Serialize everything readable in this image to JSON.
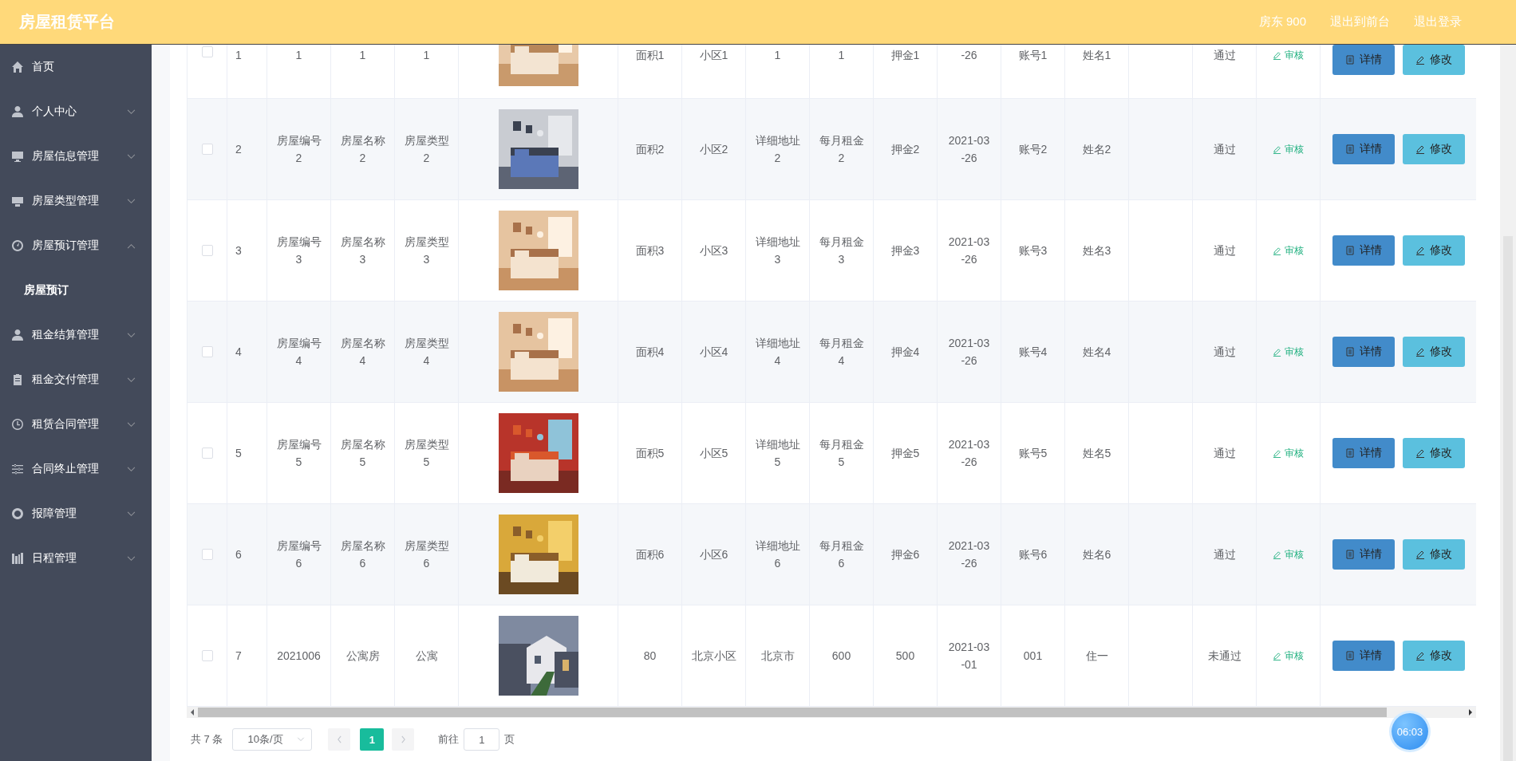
{
  "header": {
    "title": "房屋租赁平台",
    "links": [
      "房东 900",
      "退出到前台",
      "退出登录"
    ]
  },
  "sidebar": {
    "items": [
      {
        "label": "首页",
        "kind": "link"
      },
      {
        "label": "个人中心",
        "kind": "menu",
        "expanded": false
      },
      {
        "label": "房屋信息管理",
        "kind": "menu",
        "expanded": false
      },
      {
        "label": "房屋类型管理",
        "kind": "menu",
        "expanded": false
      },
      {
        "label": "房屋预订管理",
        "kind": "menu",
        "expanded": true,
        "children": [
          {
            "label": "房屋预订"
          }
        ]
      },
      {
        "label": "租金结算管理",
        "kind": "menu",
        "expanded": false
      },
      {
        "label": "租金交付管理",
        "kind": "menu",
        "expanded": false
      },
      {
        "label": "租赁合同管理",
        "kind": "menu",
        "expanded": false
      },
      {
        "label": "合同终止管理",
        "kind": "menu",
        "expanded": false
      },
      {
        "label": "报障管理",
        "kind": "menu",
        "expanded": false
      },
      {
        "label": "日程管理",
        "kind": "menu",
        "expanded": false
      }
    ]
  },
  "table": {
    "rows": [
      {
        "checked": false,
        "index": "1",
        "lead": [
          "1",
          "1",
          "1"
        ],
        "tail": [
          "面积1",
          "小区1",
          "1",
          "1",
          "押金1",
          "-26",
          "账号1",
          "姓名1"
        ],
        "status": "通过",
        "audit": "审核",
        "buttons": [
          "详情",
          "修改"
        ]
      },
      {
        "checked": false,
        "index": "2",
        "lead": [
          "房屋编号2",
          "房屋名称2",
          "房屋类型2"
        ],
        "tail": [
          "面积2",
          "小区2",
          "详细地址2",
          "每月租金2",
          "押金2",
          "2021-03-26",
          "账号2",
          "姓名2"
        ],
        "status": "通过",
        "audit": "审核",
        "buttons": [
          "详情",
          "修改"
        ]
      },
      {
        "checked": false,
        "index": "3",
        "lead": [
          "房屋编号3",
          "房屋名称3",
          "房屋类型3"
        ],
        "tail": [
          "面积3",
          "小区3",
          "详细地址3",
          "每月租金3",
          "押金3",
          "2021-03-26",
          "账号3",
          "姓名3"
        ],
        "status": "通过",
        "audit": "审核",
        "buttons": [
          "详情",
          "修改"
        ]
      },
      {
        "checked": false,
        "index": "4",
        "lead": [
          "房屋编号4",
          "房屋名称4",
          "房屋类型4"
        ],
        "tail": [
          "面积4",
          "小区4",
          "详细地址4",
          "每月租金4",
          "押金4",
          "2021-03-26",
          "账号4",
          "姓名4"
        ],
        "status": "通过",
        "audit": "审核",
        "buttons": [
          "详情",
          "修改"
        ]
      },
      {
        "checked": false,
        "index": "5",
        "lead": [
          "房屋编号5",
          "房屋名称5",
          "房屋类型5"
        ],
        "tail": [
          "面积5",
          "小区5",
          "详细地址5",
          "每月租金5",
          "押金5",
          "2021-03-26",
          "账号5",
          "姓名5"
        ],
        "status": "通过",
        "audit": "审核",
        "buttons": [
          "详情",
          "修改"
        ]
      },
      {
        "checked": false,
        "index": "6",
        "lead": [
          "房屋编号6",
          "房屋名称6",
          "房屋类型6"
        ],
        "tail": [
          "面积6",
          "小区6",
          "详细地址6",
          "每月租金6",
          "押金6",
          "2021-03-26",
          "账号6",
          "姓名6"
        ],
        "status": "通过",
        "audit": "审核",
        "buttons": [
          "详情",
          "修改"
        ]
      },
      {
        "checked": false,
        "index": "7",
        "lead": [
          "2021006",
          "公寓房",
          "公寓"
        ],
        "tail": [
          "80",
          "北京小区",
          "北京市",
          "600",
          "500",
          "2021-03-01",
          "001",
          "住一"
        ],
        "status": "未通过",
        "audit": "审核",
        "buttons": [
          "详情",
          "修改"
        ]
      }
    ]
  },
  "pagination": {
    "total": "共 7 条",
    "page_size": "10条/页",
    "pages": [
      {
        "label": "1",
        "selected": true
      }
    ],
    "goto_label": "前往",
    "goto_value": "1",
    "goto_suffix": "页"
  },
  "timer": "06:03"
}
